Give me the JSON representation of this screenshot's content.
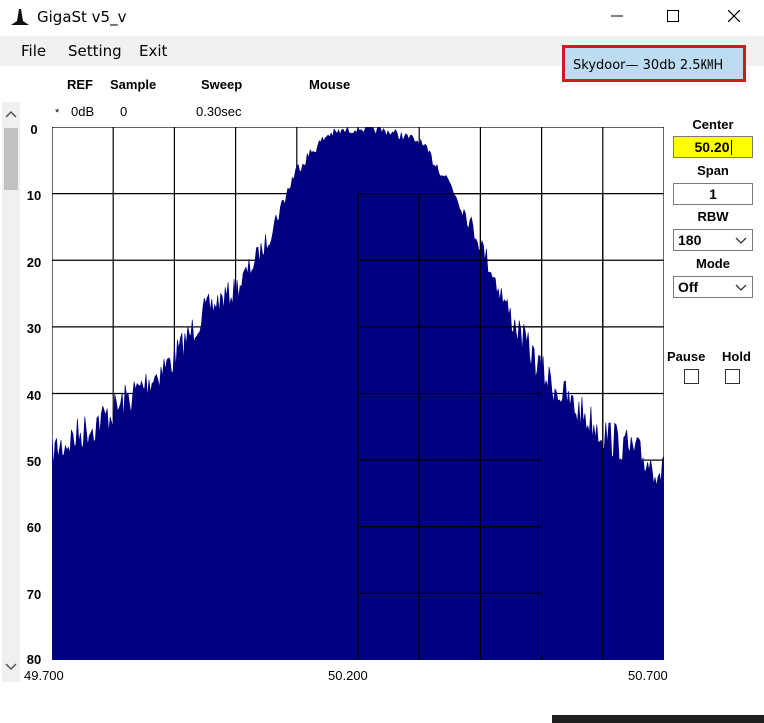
{
  "window": {
    "title": "GigaSt v5_v"
  },
  "menu": {
    "file": "File",
    "setting": "Setting",
    "exit": "Exit"
  },
  "annotation": "Skydoor— 30db   2.5㏎H",
  "header": {
    "ref_label": "REF",
    "sample_label": "Sample",
    "sweep_label": "Sweep",
    "mouse_label": "Mouse",
    "ref_marker": "*",
    "ref_value": "0dB",
    "sample_value": "0",
    "sweep_value": "0.30sec"
  },
  "controls": {
    "center_label": "Center",
    "center_value": "50.20",
    "span_label": "Span",
    "span_value": "1",
    "rbw_label": "RBW",
    "rbw_value": "180",
    "mode_label": "Mode",
    "mode_value": "Off",
    "pause_label": "Pause",
    "hold_label": "Hold"
  },
  "colors": {
    "trace": "#000080",
    "annotation_border": "#d1191f",
    "annotation_bg": "#bedcf1",
    "center_bg": "#ffff00"
  },
  "chart_data": {
    "type": "area",
    "xlim": [
      49.7,
      50.7
    ],
    "ylim": [
      0,
      80
    ],
    "y_inverted": true,
    "y_ticks": [
      "0",
      "10",
      "20",
      "30",
      "40",
      "50",
      "60",
      "70",
      "80"
    ],
    "x_tick_labels": [
      "49.700",
      "50.200",
      "50.700"
    ],
    "grid": true,
    "units_note": "",
    "x": [
      49.7,
      49.75,
      49.8,
      49.85,
      49.9,
      49.95,
      50.0,
      50.05,
      50.1,
      50.15,
      50.2,
      50.25,
      50.3,
      50.35,
      50.4,
      50.45,
      50.5,
      50.55,
      50.6,
      50.65,
      50.7
    ],
    "y": [
      48,
      45,
      42,
      38,
      34,
      27,
      24,
      17,
      6,
      1,
      0,
      0.5,
      2,
      8,
      17,
      28,
      36,
      41,
      45,
      48,
      51
    ]
  }
}
